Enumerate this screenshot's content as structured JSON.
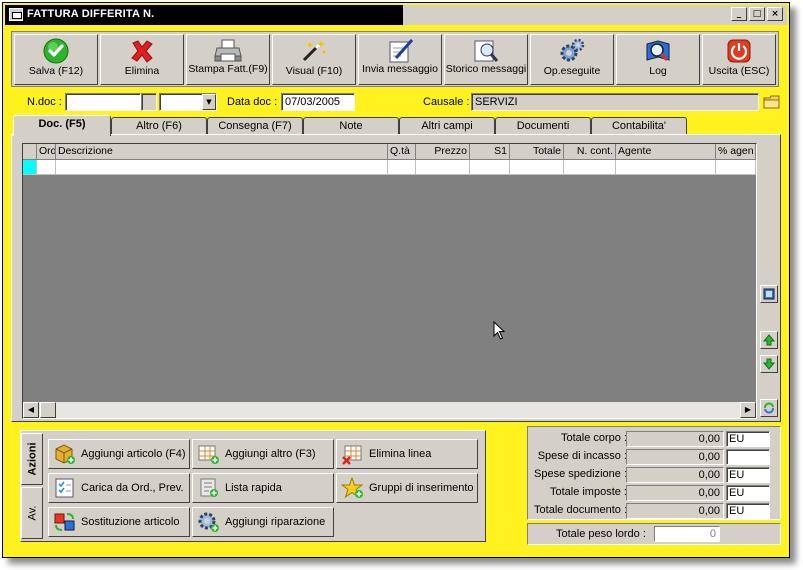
{
  "window": {
    "title": "FATTURA DIFFERITA N.",
    "controls": [
      "_",
      "□",
      "×"
    ]
  },
  "toolbar": {
    "buttons": [
      {
        "label": "Salva (F12)",
        "icon": "check-icon"
      },
      {
        "label": "Elimina",
        "icon": "x-icon"
      },
      {
        "label": "Stampa Fatt.(F9)",
        "icon": "printer-icon"
      },
      {
        "label": "Visual (F10)",
        "icon": "magic-wand-icon"
      },
      {
        "label": "Invia messaggio",
        "icon": "pen-paper-icon"
      },
      {
        "label": "Storico messaggi",
        "icon": "magnifier-paper-icon"
      },
      {
        "label": "Op.eseguite",
        "icon": "gears-icon"
      },
      {
        "label": "Log",
        "icon": "magnifier-book-icon"
      },
      {
        "label": "Uscita (ESC)",
        "icon": "power-icon"
      }
    ]
  },
  "header": {
    "ndoc_label": "N.doc :",
    "ndoc_value": "",
    "ndoc_suffix": "",
    "data_label": "Data doc :",
    "data_value": "07/03/2005",
    "causale_label": "Causale :",
    "causale_value": "SERVIZI"
  },
  "tabs": [
    {
      "label": "Doc. (F5)",
      "active": true
    },
    {
      "label": "Altro (F6)",
      "active": false
    },
    {
      "label": "Consegna (F7)",
      "active": false
    },
    {
      "label": "Note",
      "active": false
    },
    {
      "label": "Altri campi",
      "active": false
    },
    {
      "label": "Documenti",
      "active": false
    },
    {
      "label": "Contabilita'",
      "active": false
    }
  ],
  "grid": {
    "columns": [
      "Ord",
      "Descrizione",
      "Q.tà",
      "Prezzo",
      "S1",
      "Totale",
      "N. cont.",
      "Agente",
      "% agen"
    ],
    "rows": [
      [
        "",
        "",
        "",
        "",
        "",
        "",
        "",
        "",
        ""
      ]
    ]
  },
  "actions": {
    "vtabs": [
      "Azioni",
      "Av."
    ],
    "buttons": [
      {
        "label": "Aggiungi articolo (F4)",
        "icon": "box-add-icon"
      },
      {
        "label": "Aggiungi altro (F3)",
        "icon": "grid-add-icon"
      },
      {
        "label": "Elimina linea",
        "icon": "grid-delete-icon"
      },
      {
        "label": "Carica da Ord., Prev.",
        "icon": "checklist-icon"
      },
      {
        "label": "Lista rapida",
        "icon": "list-add-icon"
      },
      {
        "label": "Gruppi di inserimento",
        "icon": "star-add-icon"
      },
      {
        "label": "Sostituzione articolo",
        "icon": "swap-icon"
      },
      {
        "label": "Aggiungi riparazione",
        "icon": "gear-add-icon"
      }
    ]
  },
  "totals": {
    "rows": [
      {
        "label": "Totale corpo :",
        "value": "0,00",
        "currency": "EU"
      },
      {
        "label": "Spese di incasso :",
        "value": "0,00",
        "currency": ""
      },
      {
        "label": "Spese spedizione :",
        "value": "0,00",
        "currency": "EU"
      },
      {
        "label": "Totale imposte :",
        "value": "0,00",
        "currency": "EU"
      },
      {
        "label": "Totale documento :",
        "value": "0,00",
        "currency": "EU"
      }
    ],
    "peso_label": "Totale peso lordo :",
    "peso_value": "0"
  },
  "colors": {
    "window_bg": "#FFF21E",
    "face": "#d4d0c8",
    "grid_bg": "#808080",
    "selected_cell": "#00FFFF"
  }
}
